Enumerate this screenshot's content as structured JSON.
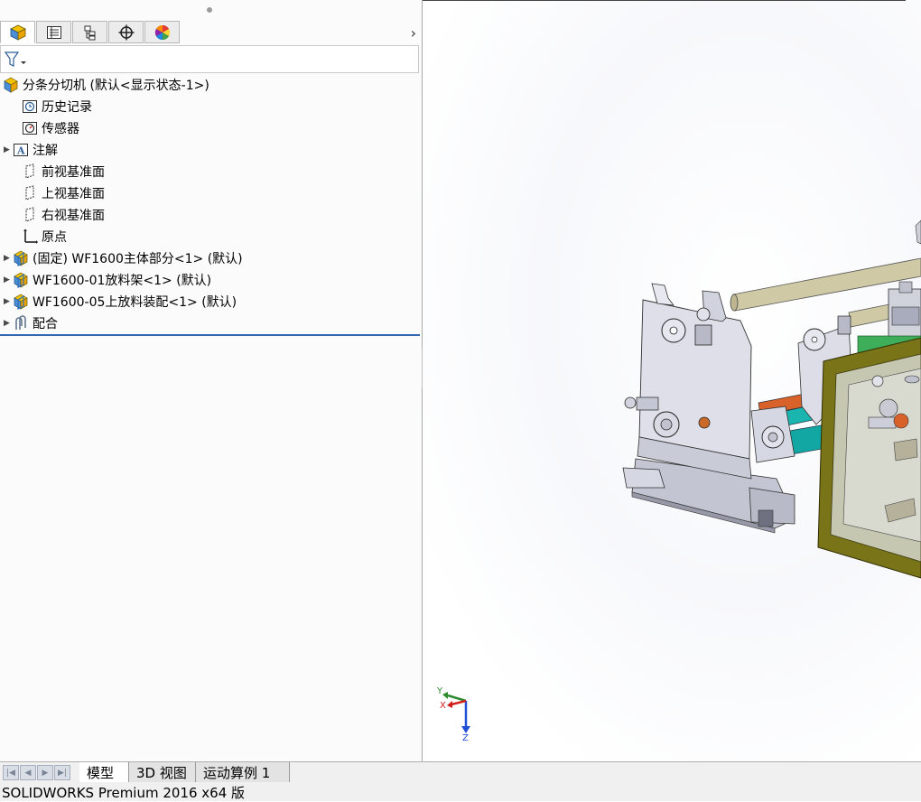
{
  "tabs": [
    {
      "name": "featuremanager",
      "icon": "featuremanager-tree-icon"
    },
    {
      "name": "propertymanager",
      "icon": "propertymanager-icon"
    },
    {
      "name": "configurationmanager",
      "icon": "configurationmanager-icon"
    },
    {
      "name": "dimxpertmanager",
      "icon": "dimxpert-crosshair-icon"
    },
    {
      "name": "displaymanager",
      "icon": "displaymanager-color-wheel-icon"
    }
  ],
  "tree": {
    "root_label": "分条分切机  (默认<显示状态-1>)",
    "items": [
      {
        "label": "历史记录",
        "icon": "history-icon",
        "expandable": false
      },
      {
        "label": "传感器",
        "icon": "sensor-icon",
        "expandable": false
      },
      {
        "label": "注解",
        "icon": "annotation-icon",
        "expandable": true
      },
      {
        "label": "前视基准面",
        "icon": "plane-icon",
        "expandable": false
      },
      {
        "label": "上视基准面",
        "icon": "plane-icon",
        "expandable": false
      },
      {
        "label": "右视基准面",
        "icon": "plane-icon",
        "expandable": false
      },
      {
        "label": "原点",
        "icon": "origin-icon",
        "expandable": false
      },
      {
        "label": "(固定) WF1600主体部分<1> (默认)",
        "icon": "subassembly-icon",
        "expandable": true
      },
      {
        "label": "WF1600-01放料架<1> (默认)",
        "icon": "subassembly-icon",
        "expandable": true
      },
      {
        "label": "WF1600-05上放料装配<1> (默认)",
        "icon": "subassembly-icon",
        "expandable": true
      },
      {
        "label": "配合",
        "icon": "mates-icon",
        "expandable": true
      }
    ]
  },
  "triad": {
    "y": "Y",
    "x": "X",
    "z": "Z"
  },
  "bottom_tabs": [
    "模型",
    "3D 视图",
    "运动算例 1"
  ],
  "active_bottom_tab": "模型",
  "status_text": "SOLIDWORKS Premium 2016 x64 版",
  "colors": {
    "selection_line": "#3167b0",
    "frame_olive": "#7a7418",
    "roller_teal": "#12a7a3",
    "roller_orange": "#d9622b"
  }
}
